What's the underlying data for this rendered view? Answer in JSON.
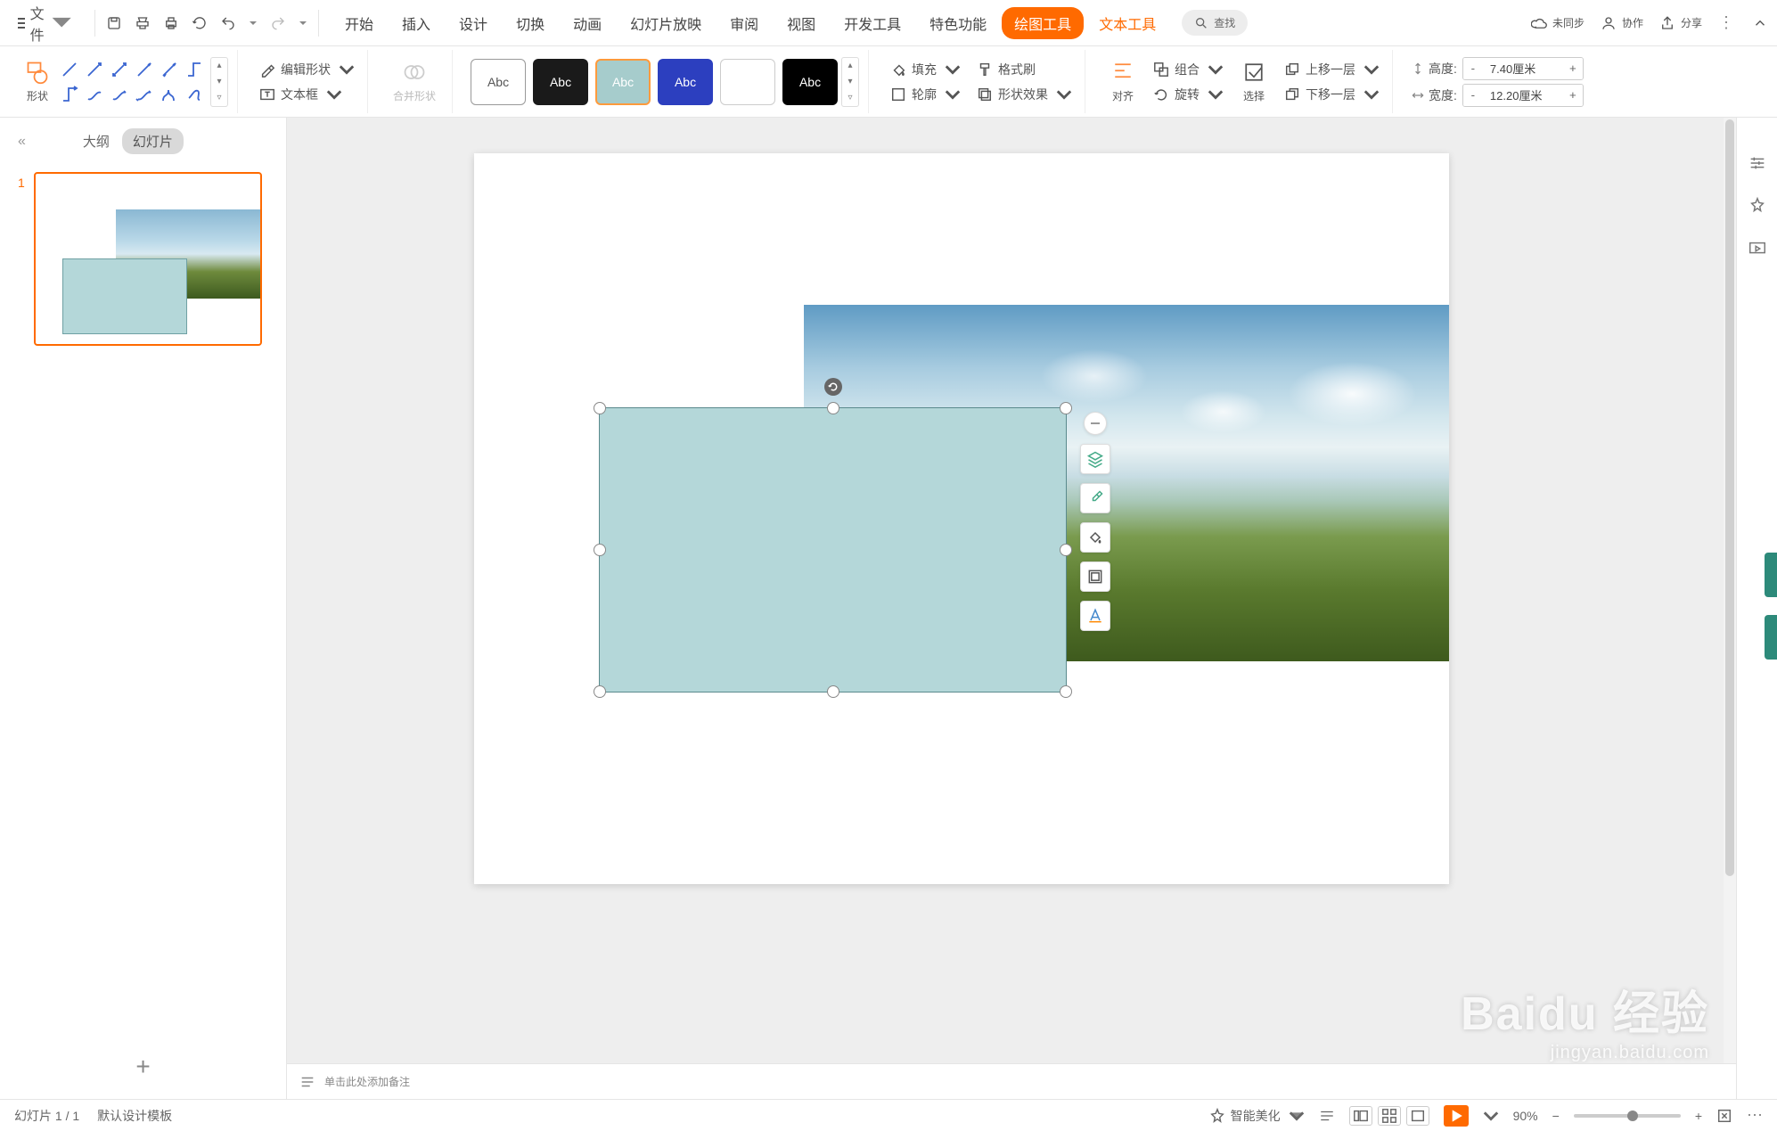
{
  "menu": {
    "file": "文件",
    "tabs": [
      "开始",
      "插入",
      "设计",
      "切换",
      "动画",
      "幻灯片放映",
      "审阅",
      "视图",
      "开发工具",
      "特色功能"
    ],
    "drawing_tools": "绘图工具",
    "text_tools": "文本工具",
    "search": "查找",
    "unsync": "未同步",
    "collab": "协作",
    "share": "分享"
  },
  "ribbon": {
    "shape_btn": "形状",
    "edit_shape": "编辑形状",
    "textbox": "文本框",
    "merge_shapes": "合并形状",
    "style_label": "Abc",
    "fill": "填充",
    "outline": "轮廓",
    "format_painter": "格式刷",
    "shape_effects": "形状效果",
    "align": "对齐",
    "group": "组合",
    "rotate": "旋转",
    "select": "选择",
    "bring_forward": "上移一层",
    "send_backward": "下移一层",
    "height_label": "高度:",
    "width_label": "宽度:",
    "height_value": "7.40厘米",
    "width_value": "12.20厘米"
  },
  "thumbs": {
    "outline_tab": "大纲",
    "slides_tab": "幻灯片",
    "slide_number": "1"
  },
  "notes_placeholder": "单击此处添加备注",
  "status": {
    "slide_counter": "幻灯片 1 / 1",
    "template": "默认设计模板",
    "beautify": "智能美化",
    "zoom": "90%"
  },
  "watermark": {
    "brand": "Baidu 经验",
    "url": "jingyan.baidu.com"
  },
  "colors": {
    "accent": "#ff6a00",
    "shape_fill": "#b4d7d9"
  }
}
